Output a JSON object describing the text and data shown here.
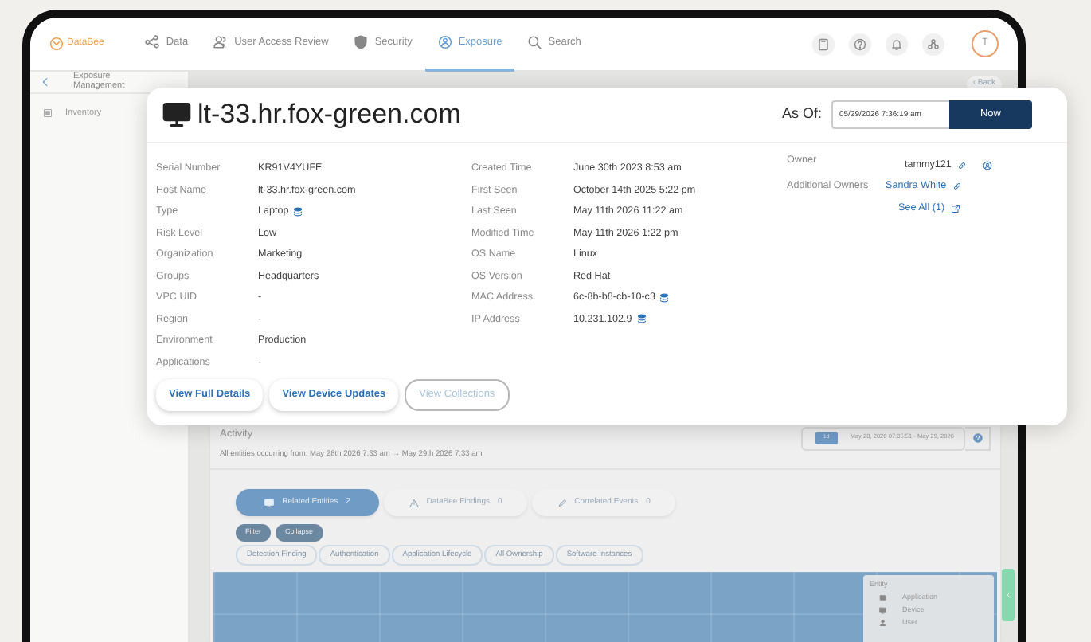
{
  "nav": {
    "logo": "DataBee",
    "items": [
      {
        "label": "Data",
        "kind": "data",
        "selected": false
      },
      {
        "label": "User Access Review",
        "kind": "users",
        "selected": false
      },
      {
        "label": "Security",
        "kind": "shield",
        "selected": false
      },
      {
        "label": "Exposure",
        "kind": "exposure",
        "selected": true
      },
      {
        "label": "Search",
        "kind": "search",
        "selected": false
      }
    ],
    "avatar": "T"
  },
  "sidebar": {
    "title": "Exposure Management",
    "items": [
      {
        "label": "Inventory",
        "selected": false
      }
    ]
  },
  "back_link": "‹ Back",
  "device_card": {
    "title": "lt-33.hr.fox-green.com",
    "as_of_label": "As Of:",
    "as_of_value": "05/29/2026 7:36:19 am",
    "now_button": "Now",
    "columns": [
      [
        {
          "label": "Serial Number",
          "value": "KR91V4YUFE",
          "kind": "text"
        },
        {
          "label": "Host Name",
          "value": "lt-33.hr.fox-green.com",
          "kind": "text"
        },
        {
          "label": "Type",
          "value": "Laptop",
          "kind": "database"
        },
        {
          "label": "Risk Level",
          "value": "Low",
          "kind": "text"
        },
        {
          "label": "Organization",
          "value": "Marketing",
          "kind": "text"
        },
        {
          "label": "Groups",
          "value": "Headquarters",
          "kind": "text"
        },
        {
          "label": "VPC UID",
          "value": "-",
          "kind": "text"
        },
        {
          "label": "Region",
          "value": "-",
          "kind": "text"
        },
        {
          "label": "Environment",
          "value": "Production",
          "kind": "text"
        },
        {
          "label": "Applications",
          "value": "-",
          "kind": "text"
        }
      ],
      [
        {
          "label": "Created Time",
          "value": "June 30th 2023 8:53 am",
          "kind": "text"
        },
        {
          "label": "First Seen",
          "value": "October 14th 2025 5:22 pm",
          "kind": "text"
        },
        {
          "label": "Last Seen",
          "value": "May 11th 2026 11:22 am",
          "kind": "text"
        },
        {
          "label": "Modified Time",
          "value": "May 11th 2026 1:22 pm",
          "kind": "text"
        },
        {
          "label": "OS Name",
          "value": "Linux",
          "kind": "text"
        },
        {
          "label": "OS Version",
          "value": "Red Hat",
          "kind": "text"
        },
        {
          "label": "MAC Address",
          "value": "6c-8b-b8-cb-10-c3",
          "kind": "database"
        },
        {
          "label": "IP Address",
          "value": "10.231.102.9",
          "kind": "database"
        }
      ]
    ],
    "owners": [
      {
        "label": "Owner",
        "value": "tammy121",
        "kind": "user"
      },
      {
        "label": "Additional Owners",
        "value": "Sandra White",
        "kind": "link"
      }
    ],
    "see_all": "See All (1)",
    "buttons": [
      {
        "label": "View Full Details",
        "disabled": false
      },
      {
        "label": "View Device Updates",
        "disabled": false
      },
      {
        "label": "View Collections",
        "disabled": true
      }
    ]
  },
  "activity": {
    "title": "Activity",
    "subtitle": "All entities occurring from: May 28th 2026 7:33 am → May 29th 2026 7:33 am",
    "range_chip": "1d",
    "range_text": "May 28, 2026 07:35:51 - May 29, 2026",
    "tabs": [
      {
        "label": "Related Entities",
        "count": "2",
        "kind": "monitor",
        "selected": true
      },
      {
        "label": "DataBee Findings",
        "count": "0",
        "kind": "warning",
        "selected": false
      },
      {
        "label": "Correlated Events",
        "count": "0",
        "kind": "pencil",
        "selected": false
      }
    ],
    "actions": [
      "Filter",
      "Collapse"
    ],
    "chips": [
      "Detection Finding",
      "Authentication",
      "Application Lifecycle",
      "All Ownership",
      "Software Instances"
    ],
    "legend": {
      "title": "Entity",
      "items": [
        {
          "label": "Application",
          "kind": "application"
        },
        {
          "label": "Device",
          "kind": "monitor"
        },
        {
          "label": "User",
          "kind": "user"
        }
      ]
    }
  }
}
